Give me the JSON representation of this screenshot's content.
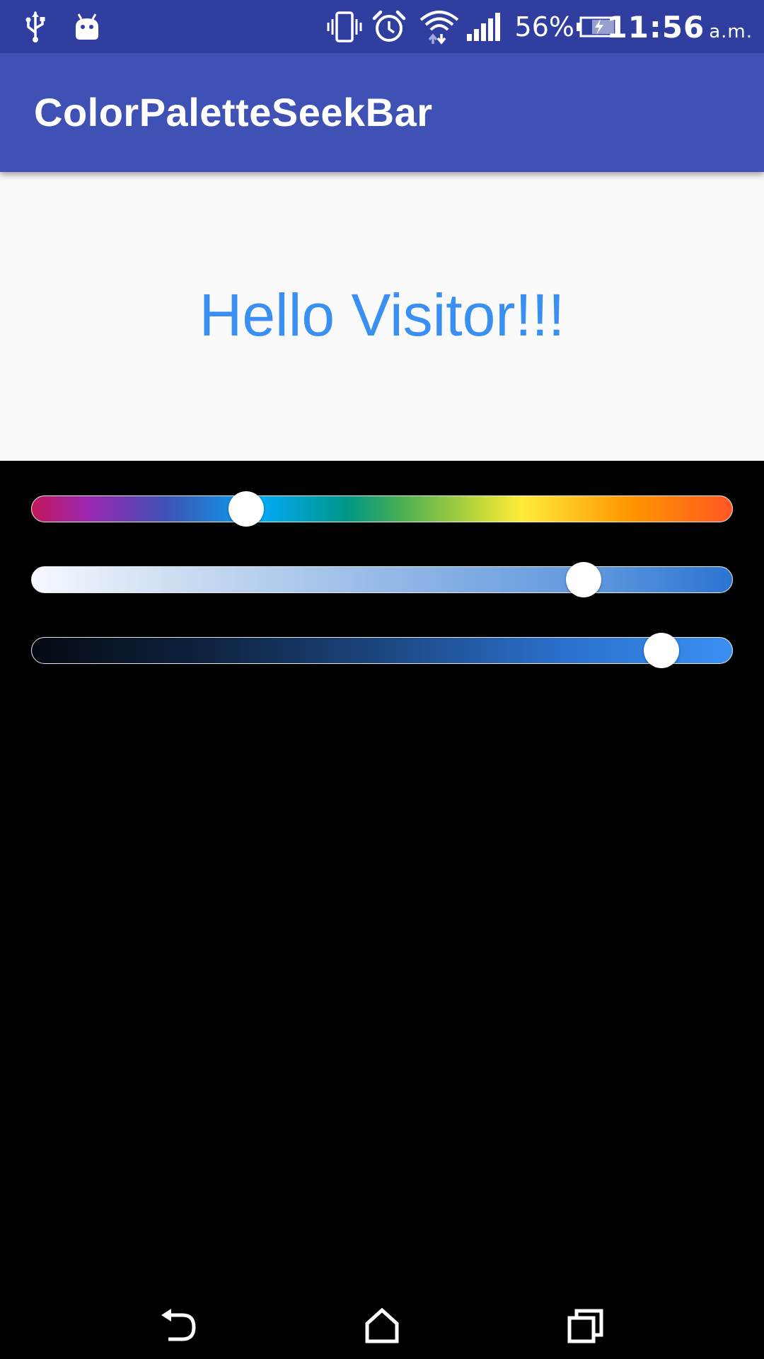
{
  "status_bar": {
    "icons": [
      "usb-icon",
      "android-debug-icon",
      "vibrate-icon",
      "alarm-icon",
      "wifi-icon",
      "cell-signal-icon",
      "battery-charging-icon"
    ],
    "battery_percent": "56%",
    "time": "11:56",
    "ampm": "a.m.",
    "background": "#303f9f"
  },
  "app_bar": {
    "title": "ColorPaletteSeekBar",
    "background": "#3f51b5"
  },
  "main": {
    "greeting": "Hello Visitor!!!",
    "greeting_color": "#3a8ff3",
    "seekbars": [
      {
        "name": "color-palette",
        "value": 0.3
      },
      {
        "name": "lightness",
        "value": 0.8
      },
      {
        "name": "darkness",
        "value": 0.915
      }
    ]
  },
  "nav_bar": {
    "buttons": [
      "back-icon",
      "home-icon",
      "recents-icon"
    ]
  }
}
